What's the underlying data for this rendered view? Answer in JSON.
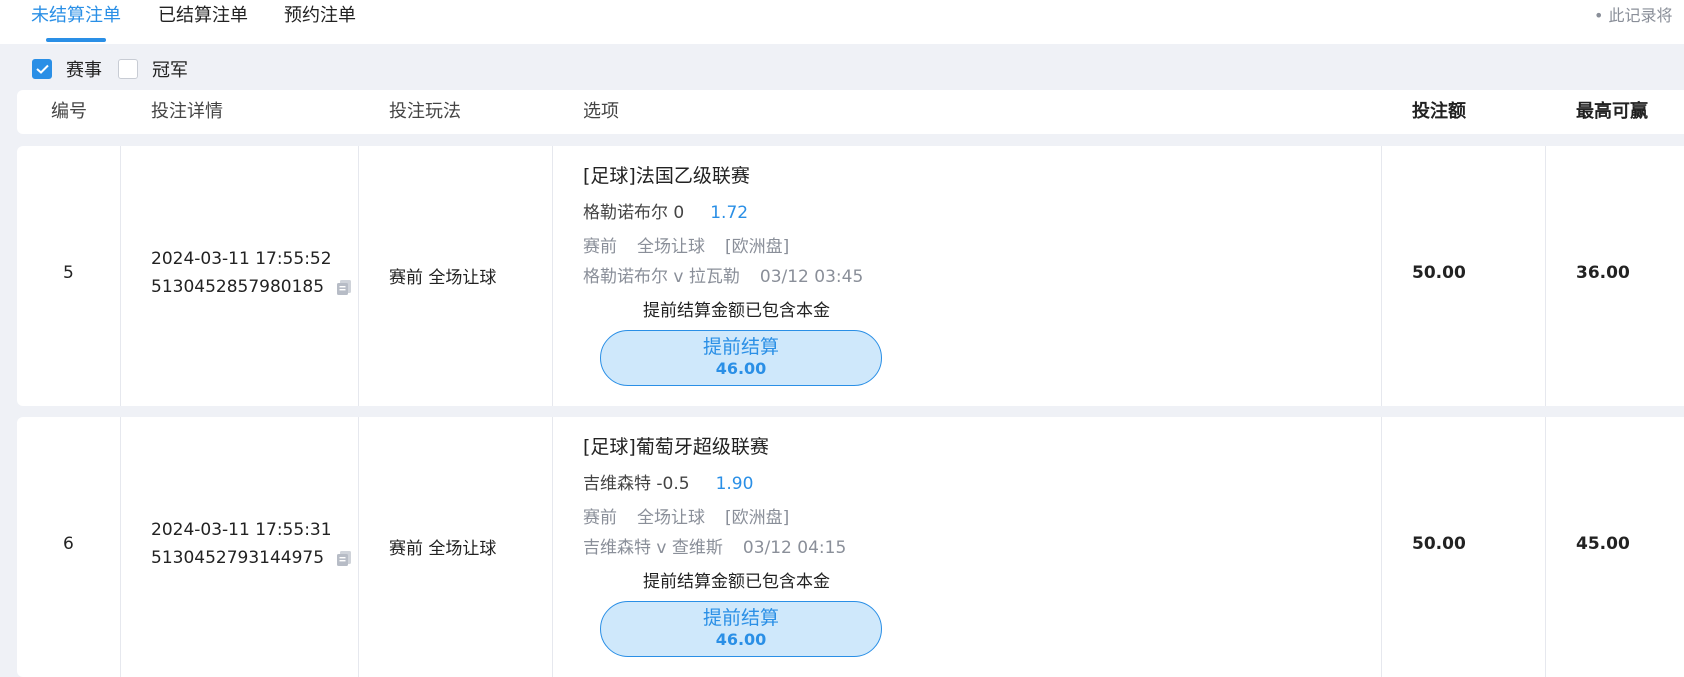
{
  "tabs": [
    {
      "label": "未结算注单",
      "active": true
    },
    {
      "label": "已结算注单",
      "active": false
    },
    {
      "label": "预约注单",
      "active": false
    }
  ],
  "notice": "• 此记录将",
  "filters": [
    {
      "label": "赛事",
      "checked": true
    },
    {
      "label": "冠军",
      "checked": false
    }
  ],
  "table": {
    "headers": {
      "id": "编号",
      "detail": "投注详情",
      "play": "投注玩法",
      "option": "选项",
      "stake": "投注额",
      "max_win": "最高可赢"
    },
    "rows": [
      {
        "id": "5",
        "datetime": "2024-03-11 17:55:52",
        "order_no": "5130452857980185",
        "play": "赛前 全场让球",
        "league": "[足球]法国乙级联赛",
        "selection": "格勒诺布尔 0",
        "odds": "1.72",
        "market_stage": "赛前",
        "market_type": "全场让球",
        "market_plate": "[欧洲盘]",
        "match": "格勒诺布尔 v 拉瓦勒",
        "match_time": "03/12 03:45",
        "note": "提前结算金额已包含本金",
        "cashout_label": "提前结算",
        "cashout_amount": "46.00",
        "stake": "50.00",
        "max_win": "36.00"
      },
      {
        "id": "6",
        "datetime": "2024-03-11 17:55:31",
        "order_no": "5130452793144975",
        "play": "赛前 全场让球",
        "league": "[足球]葡萄牙超级联赛",
        "selection": "吉维森特 -0.5",
        "odds": "1.90",
        "market_stage": "赛前",
        "market_type": "全场让球",
        "market_plate": "[欧洲盘]",
        "match": "吉维森特 v 查维斯",
        "match_time": "03/12 04:15",
        "note": "提前结算金额已包含本金",
        "cashout_label": "提前结算",
        "cashout_amount": "46.00",
        "stake": "50.00",
        "max_win": "45.00"
      }
    ]
  },
  "colors": {
    "accent": "#2a8fe6",
    "muted": "#8a8f99",
    "page_bg": "#eff1f6"
  },
  "icons": {
    "copy": "copy-icon",
    "check": "check-icon"
  }
}
